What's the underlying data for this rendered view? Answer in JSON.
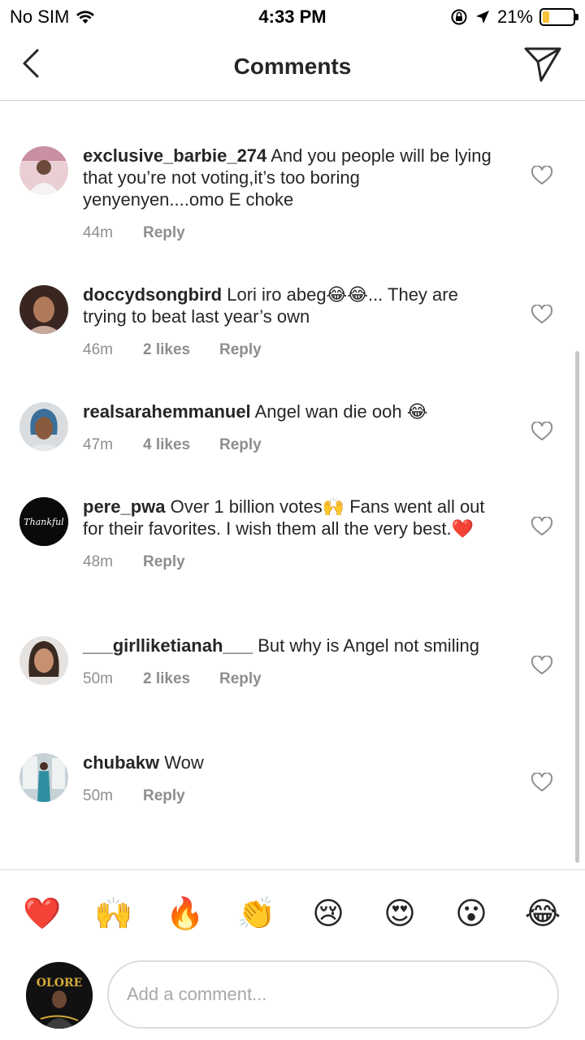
{
  "status_bar": {
    "carrier": "No SIM",
    "time": "4:33 PM",
    "battery": "21%",
    "battery_level": 0.21
  },
  "header": {
    "title": "Comments",
    "back_icon": "chevron-left-icon",
    "send_icon": "paper-plane-icon"
  },
  "comments": [
    {
      "username": "exclusive_barbie_274",
      "text": "And you people will be lying that you’re not voting,it’s too boring yenyenyen....omo E choke",
      "time": "44m",
      "likes": "",
      "reply": "Reply"
    },
    {
      "username": "doccydsongbird",
      "text": "Lori iro abeg😂😂... They are trying to beat last year’s own",
      "time": "46m",
      "likes": "2 likes",
      "reply": "Reply"
    },
    {
      "username": "realsarahemmanuel",
      "text": "Angel wan die ooh 😂",
      "time": "47m",
      "likes": "4 likes",
      "reply": "Reply"
    },
    {
      "username": "pere_pwa",
      "text": "Over 1 billion votes🙌 Fans went all out for their favorites. I wish them all the very best.❤️",
      "time": "48m",
      "likes": "",
      "reply": "Reply",
      "avatar_text": "Thankful"
    },
    {
      "username": "___girlliketianah___",
      "text": "But why is Angel not smiling",
      "time": "50m",
      "likes": "2 likes",
      "reply": "Reply"
    },
    {
      "username": "chubakw",
      "text": "Wow",
      "time": "50m",
      "likes": "",
      "reply": "Reply"
    }
  ],
  "emoji_bar": [
    "❤️",
    "🙌",
    "🔥",
    "👏",
    "😢",
    "😍",
    "😮",
    "😂"
  ],
  "composer": {
    "placeholder": "Add a comment...",
    "avatar_text": "OLORE"
  }
}
